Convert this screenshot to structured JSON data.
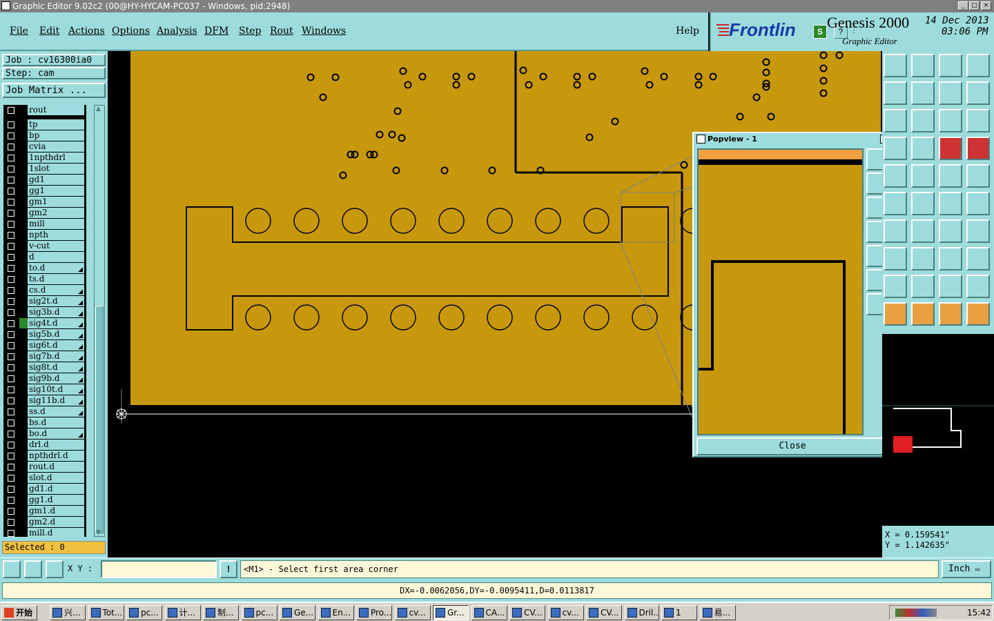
{
  "window": {
    "title": "Graphic Editor 9.02c2 (00@HY-HYCAM-PC037 - Windows, pid:2948)"
  },
  "menu": {
    "file": "File",
    "edit": "Edit",
    "actions": "Actions",
    "options": "Options",
    "analysis": "Analysis",
    "dfm": "DFM",
    "step": "Step",
    "rout": "Rout",
    "windows": "Windows",
    "help": "Help"
  },
  "brand": {
    "logo": "Frontlin",
    "product": "Genesis 2000",
    "subtitle": "Graphic Editor",
    "date": "14 Dec 2013",
    "time": "03:06 PM"
  },
  "job": {
    "job_label": "Job : cv16300ia0",
    "step_label": "Step: cam",
    "matrix_button": "Job Matrix ..."
  },
  "layers": {
    "top": "rout",
    "items": [
      {
        "name": "tp",
        "arrow": false
      },
      {
        "name": "bp",
        "arrow": false
      },
      {
        "name": "cvia",
        "arrow": false
      },
      {
        "name": "1npthdrl",
        "arrow": false
      },
      {
        "name": "1slot",
        "arrow": false
      },
      {
        "name": "gd1",
        "arrow": false
      },
      {
        "name": "gg1",
        "arrow": false
      },
      {
        "name": "gm1",
        "arrow": false
      },
      {
        "name": "gm2",
        "arrow": false
      },
      {
        "name": "mill",
        "arrow": false
      },
      {
        "name": "npth",
        "arrow": false
      },
      {
        "name": "v-cut",
        "arrow": false
      },
      {
        "name": "d",
        "arrow": false
      },
      {
        "name": "to.d",
        "arrow": true
      },
      {
        "name": "ts.d",
        "arrow": false
      },
      {
        "name": "cs.d",
        "arrow": true
      },
      {
        "name": "sig2t.d",
        "arrow": true
      },
      {
        "name": "sig3b.d",
        "arrow": true
      },
      {
        "name": "sig4t.d",
        "arrow": true,
        "active": true
      },
      {
        "name": "sig5b.d",
        "arrow": true
      },
      {
        "name": "sig6t.d",
        "arrow": true
      },
      {
        "name": "sig7b.d",
        "arrow": true
      },
      {
        "name": "sig8t.d",
        "arrow": true
      },
      {
        "name": "sig9b.d",
        "arrow": true
      },
      {
        "name": "sig10t.d",
        "arrow": true
      },
      {
        "name": "sig11b.d",
        "arrow": true
      },
      {
        "name": "ss.d",
        "arrow": true
      },
      {
        "name": "bs.d",
        "arrow": false
      },
      {
        "name": "bo.d",
        "arrow": true
      },
      {
        "name": "drl.d",
        "arrow": false
      },
      {
        "name": "npthdrl.d",
        "arrow": false
      },
      {
        "name": "rout.d",
        "arrow": false
      },
      {
        "name": "slot.d",
        "arrow": false
      },
      {
        "name": "gd1.d",
        "arrow": false
      },
      {
        "name": "gg1.d",
        "arrow": false
      },
      {
        "name": "gm1.d",
        "arrow": false
      },
      {
        "name": "gm2.d",
        "arrow": false
      },
      {
        "name": "mill.d",
        "arrow": false
      }
    ]
  },
  "selected": "Selected : 0",
  "popview": {
    "title": "Popview - 1",
    "close": "Close",
    "close_x": "×"
  },
  "coords": {
    "x": "X = 0.159541\"",
    "y": "Y = 1.142635\""
  },
  "command": {
    "xy_label": "X Y :",
    "prompt": "<M1> - Select first area corner",
    "unit": "Inch",
    "excl": "!"
  },
  "status": "DX=-0.0062056,DY=-0.0095411,D=0.0113817",
  "taskbar": {
    "start": "开始",
    "tasks": [
      "兴...",
      "Tot...",
      "pc...",
      "计...",
      "制...",
      "pc...",
      "Ge...",
      "En...",
      "Pro...",
      "cv...",
      "Gr...",
      "CA...",
      "CV...",
      "cv...",
      "CV...",
      "Dril...",
      "1",
      "易..."
    ],
    "clock": "15:42"
  },
  "colors": {
    "panel": "#9cdcdc",
    "board": "#c8980c",
    "accent_red": "#cc3333"
  }
}
